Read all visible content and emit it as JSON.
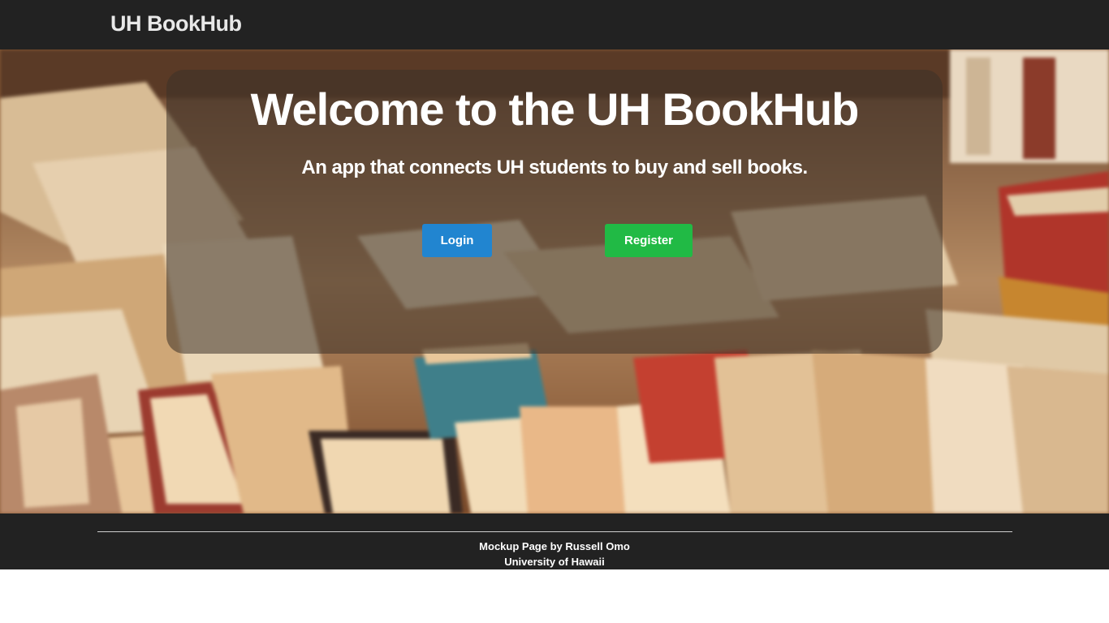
{
  "navbar": {
    "brand": "UH BookHub"
  },
  "hero": {
    "title": "Welcome to the UH BookHub",
    "subtitle": "An app that connects UH students to buy and sell books.",
    "background_image": "blurred-stack-of-old-books"
  },
  "actions": {
    "login_label": "Login",
    "register_label": "Register"
  },
  "footer": {
    "line1": "Mockup Page by Russell Omo",
    "line2": "University of Hawaii"
  },
  "colors": {
    "navbar_bg": "#222222",
    "login_button": "#2185d0",
    "register_button": "#21ba45",
    "panel_overlay": "rgba(60,50,40,0.55)"
  }
}
